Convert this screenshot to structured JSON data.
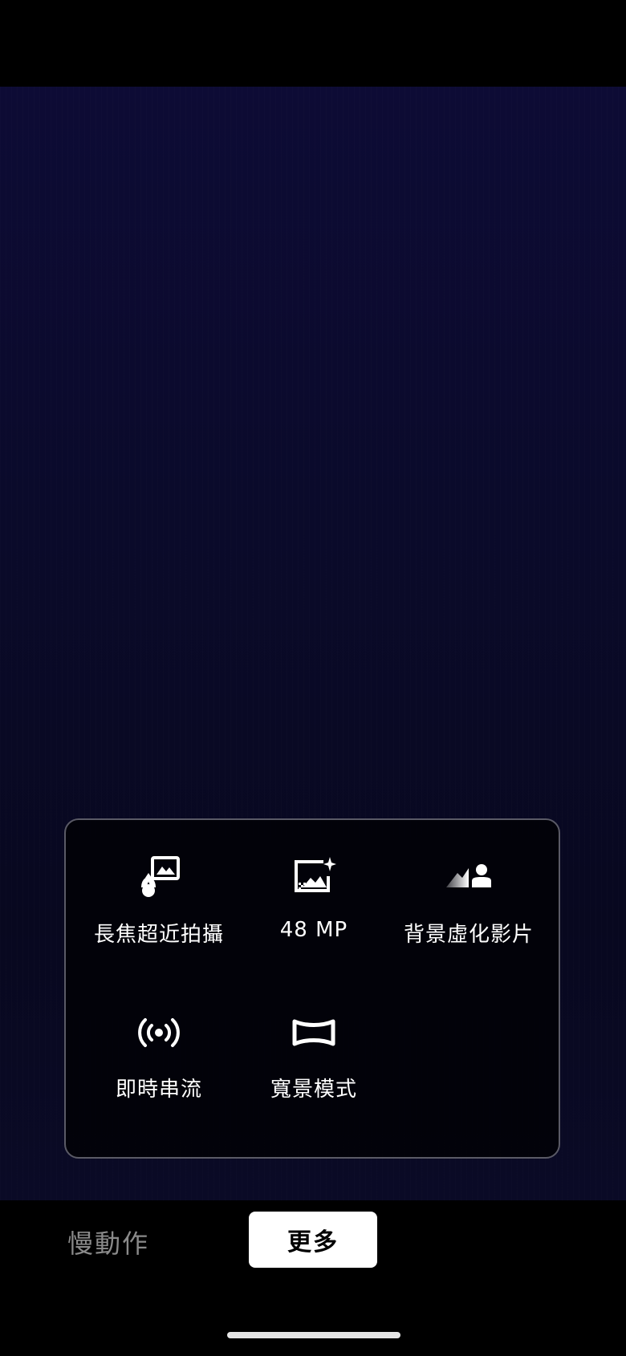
{
  "panel": {
    "modes": [
      {
        "label": "長焦超近拍攝",
        "icon": "tele-macro-icon"
      },
      {
        "label": "48 MP",
        "icon": "48mp-icon"
      },
      {
        "label": "背景虛化影片",
        "icon": "bokeh-video-icon"
      },
      {
        "label": "即時串流",
        "icon": "live-stream-icon"
      },
      {
        "label": "寬景模式",
        "icon": "panorama-icon"
      }
    ]
  },
  "bottom_tabs": {
    "slow_motion": "慢動作",
    "more": "更多"
  }
}
